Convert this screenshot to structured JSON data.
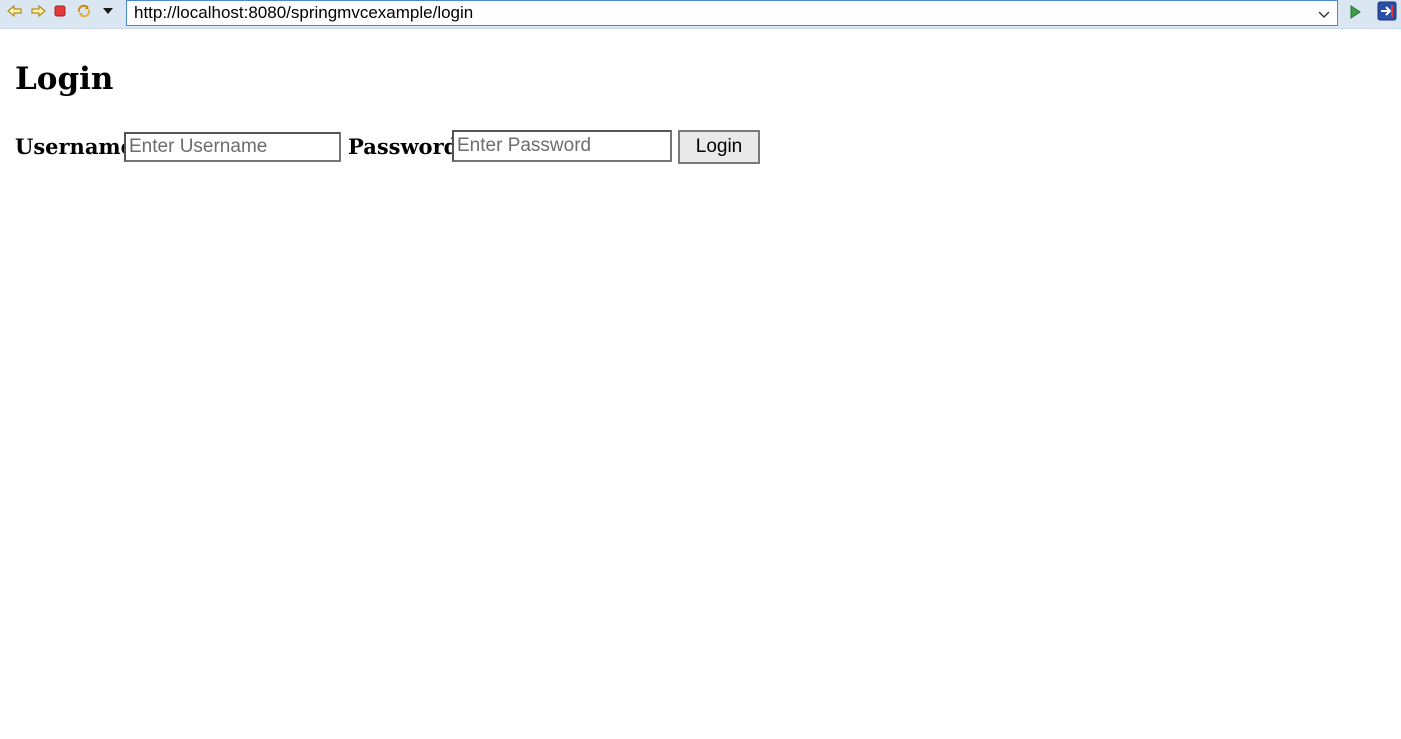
{
  "browser": {
    "url": "http://localhost:8080/springmvcexample/login",
    "icons": [
      "back-icon",
      "forward-icon",
      "stop-icon",
      "refresh-icon",
      "history-dropdown-icon",
      "url-dropdown-icon",
      "go-icon",
      "open-external-icon"
    ]
  },
  "page": {
    "title": "Login",
    "form": {
      "username_label": "Username",
      "username_placeholder": "Enter Username",
      "password_label": "Password",
      "password_placeholder": "Enter Password",
      "submit_label": "Login"
    }
  },
  "colors": {
    "toolbar_bg": "#dbe6f3",
    "url_border": "#4a8ad4",
    "button_bg": "#e9e9e9"
  }
}
